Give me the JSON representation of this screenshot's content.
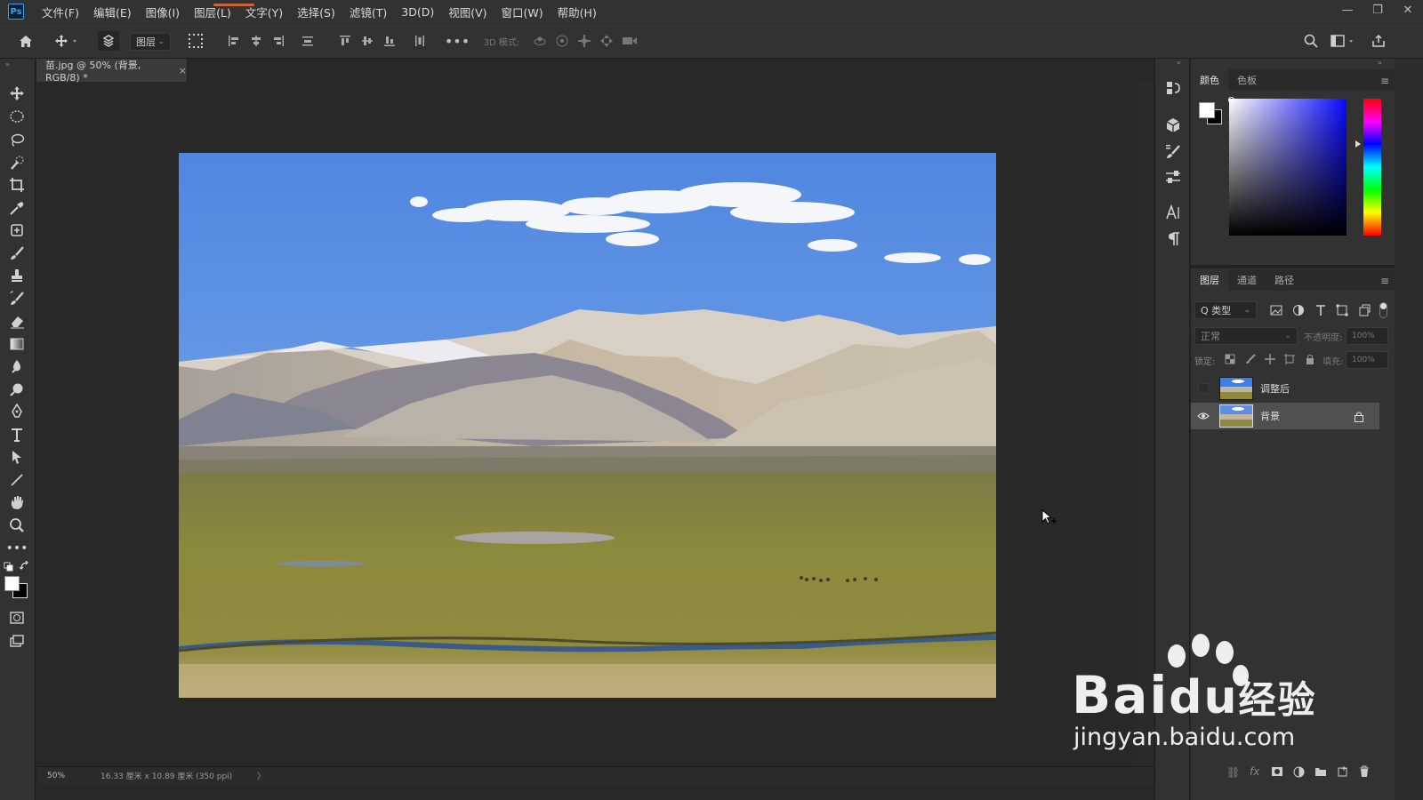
{
  "menubar": {
    "logo": "Ps",
    "items": [
      "文件(F)",
      "编辑(E)",
      "图像(I)",
      "图层(L)",
      "文字(Y)",
      "选择(S)",
      "滤镜(T)",
      "3D(D)",
      "视图(V)",
      "窗口(W)",
      "帮助(H)"
    ],
    "window_controls": [
      "—",
      "❐",
      "✕"
    ]
  },
  "options": {
    "auto_select_value": "图层",
    "mode3d_label": "3D 模式:"
  },
  "document": {
    "tab_title": "苗.jpg @ 50% (背景, RGB/8) *",
    "tab_close": "×",
    "zoom": "50%",
    "doc_size": "16.33 厘米 x 10.89 厘米 (350 ppi)",
    "status_arrow": "〉"
  },
  "color_panel": {
    "tabs": [
      "颜色",
      "色板"
    ],
    "active_tab": "颜色",
    "fg": "#ffffff",
    "bg": "#000000",
    "hue_color": "#0a0aff"
  },
  "layers_panel": {
    "tabs": [
      "图层",
      "通道",
      "路径"
    ],
    "active_tab": "图层",
    "filter_label": "Q 类型",
    "blend_mode": "正常",
    "opacity_label": "不透明度:",
    "opacity_value": "100%",
    "lock_label": "锁定:",
    "fill_label": "填充:",
    "fill_value": "100%",
    "layers": [
      {
        "name": "调整后",
        "visible": false,
        "locked": false
      },
      {
        "name": "背景",
        "visible": true,
        "locked": true
      }
    ]
  },
  "watermark": {
    "brand": "Bai",
    "brand_tail": "经验",
    "url": "jingyan.baidu.com"
  }
}
